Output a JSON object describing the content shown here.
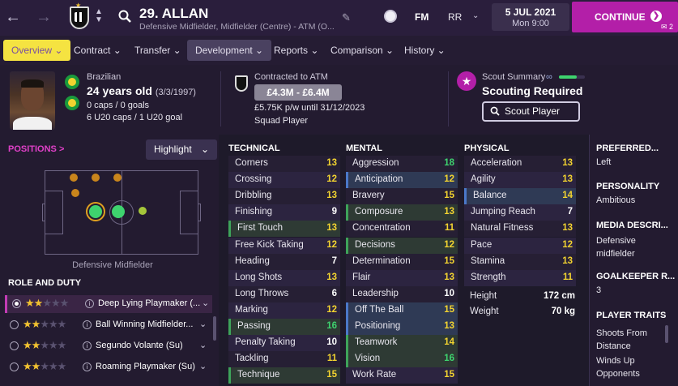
{
  "header": {
    "back_icon": "left-arrow-icon",
    "forward_icon": "right-arrow-icon",
    "player_title": "29. ALLAN",
    "player_subtitle": "Defensive Midfielder, Midfielder (Centre) - ATM (Ο...",
    "fm_label": "FM",
    "rr_label": "RR",
    "date_line1": "5 JUL 2021",
    "date_line2": "Mon 9:00",
    "continue_label": "CONTINUE",
    "continue_badge": "2"
  },
  "tabs": [
    {
      "label": "Overview",
      "state": "active"
    },
    {
      "label": "Contract",
      "state": ""
    },
    {
      "label": "Transfer",
      "state": ""
    },
    {
      "label": "Development",
      "state": "selected"
    },
    {
      "label": "Reports",
      "state": ""
    },
    {
      "label": "Comparison",
      "state": ""
    },
    {
      "label": "History",
      "state": ""
    }
  ],
  "info": {
    "nationality": "Brazilian",
    "age": "24 years old",
    "dob": "(3/3/1997)",
    "caps": "0 caps / 0 goals",
    "u20": "6 U20 caps / 1 U20 goal",
    "contract_label": "Contracted to ATM",
    "value": "£4.3M - £6.4M",
    "wage": "£5.75K p/w until 31/12/2023",
    "squad_status": "Squad Player",
    "scout_summary_label": "Scout Summary",
    "scouting_required": "Scouting Required",
    "scout_button": "Scout Player"
  },
  "positions": {
    "label": "POSITIONS >",
    "highlight_label": "Highlight",
    "position_name": "Defensive Midfielder"
  },
  "roles": {
    "title": "ROLE AND DUTY",
    "items": [
      {
        "name": "Deep Lying Playmaker (...",
        "stars": 2,
        "selected": true
      },
      {
        "name": "Ball Winning Midfielder...",
        "stars": 2,
        "selected": false
      },
      {
        "name": "Segundo Volante (Su)",
        "stars": 2,
        "selected": false
      },
      {
        "name": "Roaming Playmaker (Su)",
        "stars": 2,
        "selected": false
      }
    ]
  },
  "technical": {
    "title": "TECHNICAL",
    "attrs": [
      {
        "name": "Corners",
        "value": "13",
        "hl": ""
      },
      {
        "name": "Crossing",
        "value": "12",
        "hl": ""
      },
      {
        "name": "Dribbling",
        "value": "13",
        "hl": ""
      },
      {
        "name": "Finishing",
        "value": "9",
        "hl": ""
      },
      {
        "name": "First Touch",
        "value": "13",
        "hl": "green"
      },
      {
        "name": "Free Kick Taking",
        "value": "12",
        "hl": ""
      },
      {
        "name": "Heading",
        "value": "7",
        "hl": ""
      },
      {
        "name": "Long Shots",
        "value": "13",
        "hl": ""
      },
      {
        "name": "Long Throws",
        "value": "6",
        "hl": ""
      },
      {
        "name": "Marking",
        "value": "12",
        "hl": ""
      },
      {
        "name": "Passing",
        "value": "16",
        "hl": "green"
      },
      {
        "name": "Penalty Taking",
        "value": "10",
        "hl": ""
      },
      {
        "name": "Tackling",
        "value": "11",
        "hl": ""
      },
      {
        "name": "Technique",
        "value": "15",
        "hl": "green"
      }
    ]
  },
  "mental": {
    "title": "MENTAL",
    "attrs": [
      {
        "name": "Aggression",
        "value": "18",
        "hl": ""
      },
      {
        "name": "Anticipation",
        "value": "12",
        "hl": "blue"
      },
      {
        "name": "Bravery",
        "value": "15",
        "hl": ""
      },
      {
        "name": "Composure",
        "value": "13",
        "hl": "green"
      },
      {
        "name": "Concentration",
        "value": "11",
        "hl": ""
      },
      {
        "name": "Decisions",
        "value": "12",
        "hl": "green"
      },
      {
        "name": "Determination",
        "value": "15",
        "hl": ""
      },
      {
        "name": "Flair",
        "value": "13",
        "hl": ""
      },
      {
        "name": "Leadership",
        "value": "10",
        "hl": ""
      },
      {
        "name": "Off The Ball",
        "value": "15",
        "hl": "blue"
      },
      {
        "name": "Positioning",
        "value": "13",
        "hl": "blue"
      },
      {
        "name": "Teamwork",
        "value": "14",
        "hl": "green"
      },
      {
        "name": "Vision",
        "value": "16",
        "hl": "green"
      },
      {
        "name": "Work Rate",
        "value": "15",
        "hl": ""
      }
    ]
  },
  "physical": {
    "title": "PHYSICAL",
    "attrs": [
      {
        "name": "Acceleration",
        "value": "13",
        "hl": ""
      },
      {
        "name": "Agility",
        "value": "13",
        "hl": ""
      },
      {
        "name": "Balance",
        "value": "14",
        "hl": "blue"
      },
      {
        "name": "Jumping Reach",
        "value": "7",
        "hl": ""
      },
      {
        "name": "Natural Fitness",
        "value": "13",
        "hl": ""
      },
      {
        "name": "Pace",
        "value": "12",
        "hl": ""
      },
      {
        "name": "Stamina",
        "value": "13",
        "hl": ""
      },
      {
        "name": "Strength",
        "value": "11",
        "hl": ""
      }
    ],
    "height_label": "Height",
    "height_value": "172 cm",
    "weight_label": "Weight",
    "weight_value": "70 kg"
  },
  "sidebar": {
    "preferred_foot_title": "PREFERRED...",
    "preferred_foot_value": "Left",
    "personality_title": "PERSONALITY",
    "personality_value": "Ambitious",
    "media_title": "MEDIA DESCRI...",
    "media_value": "Defensive midfielder",
    "gk_title": "GOALKEEPER R...",
    "gk_value": "3",
    "traits_title": "PLAYER TRAITS",
    "traits": [
      "Shoots From Distance",
      "Winds Up Opponents"
    ]
  },
  "colors": {
    "accent": "#b31fa8",
    "tab_active": "#f5e341",
    "value_green": "#3ed36e",
    "value_yellow": "#f2d330",
    "value_white": "#ffffff"
  }
}
